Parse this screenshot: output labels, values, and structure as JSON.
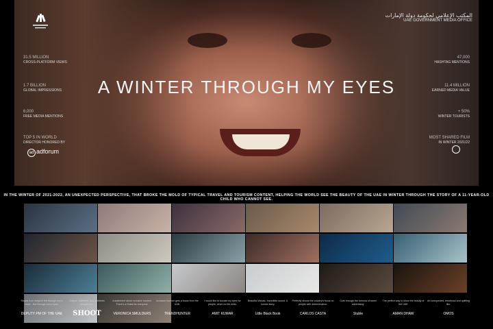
{
  "header": {
    "title": "A WINTER THROUGH MY EYES",
    "gov_logo_arabic": "المكتب الإعلامي لحكومة دولة الإمارات",
    "gov_logo_english": "UAE GOVERNMENT MEDIA OFFICE"
  },
  "stats_left": [
    {
      "num": "31.5 MILLION",
      "label": "CROSS-PLATFORM VIEWS"
    },
    {
      "num": "1.7 BILLION",
      "label": "GLOBAL IMPRESSIONS"
    },
    {
      "num": "6,000",
      "label": "FREE MEDIA MENTIONS"
    },
    {
      "num": "TOP 5 IN WORLD",
      "label": "DIRECTOR HONORED BY"
    }
  ],
  "stats_right": [
    {
      "num": "47,000",
      "label": "HASHTAG MENTIONS"
    },
    {
      "num": "11.4 MILLION",
      "label": "EARNED MEDIA VALUE"
    },
    {
      "num": "+ 50%",
      "label": "WINTER TOURISTS"
    },
    {
      "num": "MOST SHARED FILM",
      "label": "IN WINTER 2021/22"
    }
  ],
  "adforum_label": "adforum",
  "description": "IN THE WINTER OF 2021-2022, AN UNEXPECTED PERSPECTIVE, THAT BROKE THE MOLD OF TYPICAL TRAVEL AND TOURISM CONTENT, HELPING THE WORLD SEE THE BEAUTY OF THE UAE IN WINTER THROUGH THE STORY OF A 11-YEAR-OLD CHILD WHO CANNOT SEE.",
  "thumbnails": [
    {
      "c1": "#2b3440",
      "c2": "#5c6f86"
    },
    {
      "c1": "#8f7a7a",
      "c2": "#c9b3a7"
    },
    {
      "c1": "#3d3040",
      "c2": "#8a6a66"
    },
    {
      "c1": "#6b5a4a",
      "c2": "#a8896b"
    },
    {
      "c1": "#7c6c60",
      "c2": "#b9a692"
    },
    {
      "c1": "#404a55",
      "c2": "#8c7a70"
    },
    {
      "c1": "#1f2630",
      "c2": "#6e5446"
    },
    {
      "c1": "#8c8c86",
      "c2": "#cfc9bd"
    },
    {
      "c1": "#2a3a40",
      "c2": "#8aa0a8"
    },
    {
      "c1": "#3c2a28",
      "c2": "#a07060"
    },
    {
      "c1": "#0d2a48",
      "c2": "#1f5d8c"
    },
    {
      "c1": "#365f73",
      "c2": "#a9c2c9"
    },
    {
      "c1": "#1a2c3a",
      "c2": "#4c7f95"
    },
    {
      "c1": "#3b5a5c",
      "c2": "#8fb0a8"
    },
    {
      "c1": "#c6c9cc",
      "c2": "#8c8580"
    },
    {
      "c1": "#c9cdd0",
      "c2": "#e8e8e6"
    },
    {
      "c1": "#1f1a18",
      "c2": "#5b4a3e"
    },
    {
      "c1": "#1a1410",
      "c2": "#6b4026"
    },
    {
      "c1": "#6b6e72",
      "c2": "#c3c6c8"
    },
    {
      "c1": "#3a3632",
      "c2": "#8d8276"
    }
  ],
  "quotes": [
    {
      "text": "Shows how malya is felt through one's heart - Not through one's eyes.",
      "source": "DEPUTY PM OF THE UAE"
    },
    {
      "text": "Unique, unfiltered, and authentic perspective.",
      "source": "SHOOT"
    },
    {
      "text": "A statement about inclusive tourism. There's a Dubai for everyone.",
      "source": "VERONICA SMULDERS"
    },
    {
      "text": "Inclusive tourism gets a boost from the UAE.",
      "source": "TRENDHUNTER"
    },
    {
      "text": "I would like to donate my eyes for people, when no life ends.",
      "source": "AMIT KUMAR"
    },
    {
      "text": "Beautiful visuals. Incredible sound. A human story.",
      "source": "Little Black Book"
    },
    {
      "text": "Perfectly shows the country's focus on people with determination.",
      "source": "CARLOS CASTA"
    },
    {
      "text": "Cuts through the formula of travel advertising.",
      "source": "Stuble"
    },
    {
      "text": "The perfect way to show the beauty of the UAE",
      "source": "AMAN DHAW"
    },
    {
      "text": "An unexpected, emotional and uplifting film.",
      "source": "OMOS"
    }
  ]
}
